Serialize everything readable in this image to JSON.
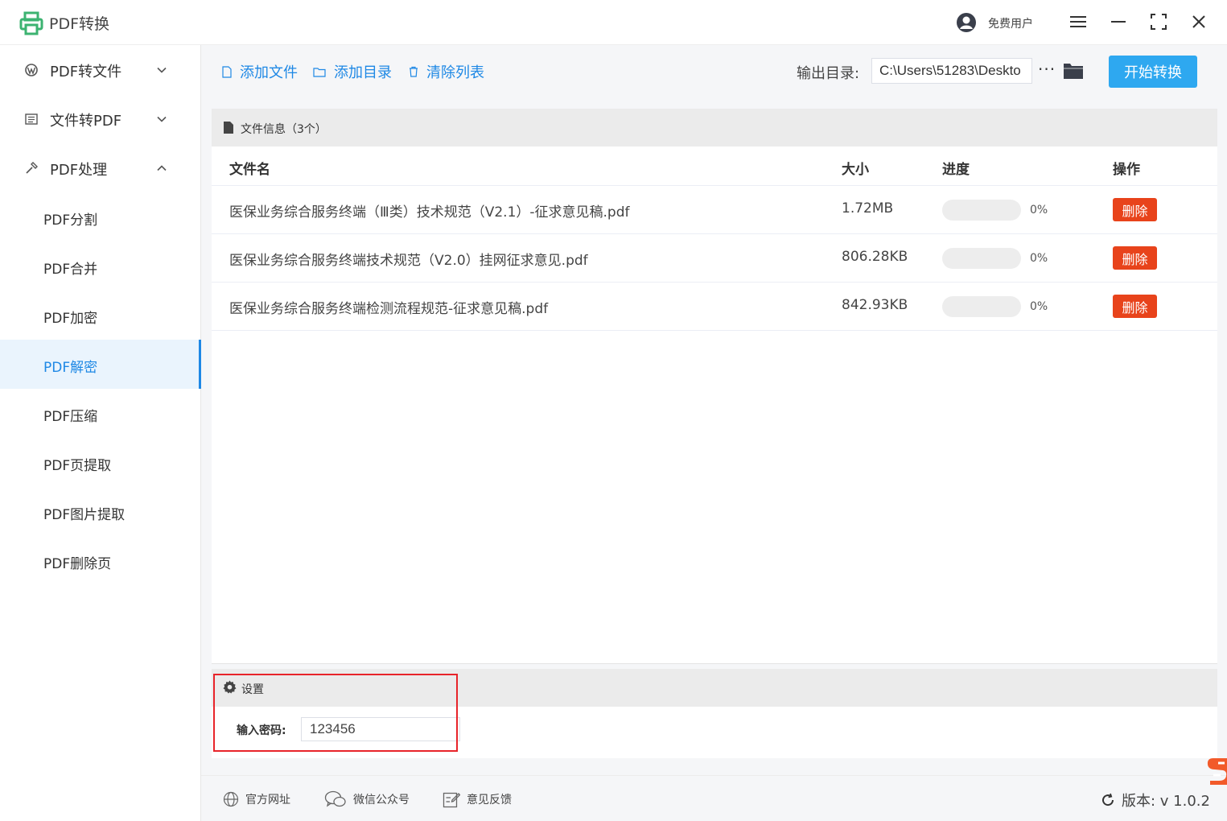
{
  "app": {
    "title": "PDF转换",
    "user_label": "免费用户"
  },
  "sidebar": {
    "groups": [
      {
        "label": "PDF转文件",
        "icon": "wordpress-icon",
        "expanded": false
      },
      {
        "label": "文件转PDF",
        "icon": "document-icon",
        "expanded": false
      },
      {
        "label": "PDF处理",
        "icon": "tool-icon",
        "expanded": true
      }
    ],
    "items": [
      {
        "label": "PDF分割"
      },
      {
        "label": "PDF合并"
      },
      {
        "label": "PDF加密"
      },
      {
        "label": "PDF解密",
        "active": true
      },
      {
        "label": "PDF压缩"
      },
      {
        "label": "PDF页提取"
      },
      {
        "label": "PDF图片提取"
      },
      {
        "label": "PDF删除页"
      }
    ]
  },
  "toolbar": {
    "add_file": "添加文件",
    "add_dir": "添加目录",
    "clear_list": "清除列表",
    "output_label": "输出目录:",
    "output_path": "C:\\Users\\51283\\Deskto",
    "more": "···",
    "start": "开始转换"
  },
  "file_panel": {
    "title": "文件信息（3个）",
    "columns": {
      "name": "文件名",
      "size": "大小",
      "progress": "进度",
      "action": "操作"
    },
    "rows": [
      {
        "name": "医保业务综合服务终端（Ⅲ类）技术规范（V2.1）-征求意见稿.pdf",
        "size": "1.72MB",
        "progress": 0,
        "progress_text": "0%",
        "action": "删除"
      },
      {
        "name": "医保业务综合服务终端技术规范（V2.0）挂网征求意见.pdf",
        "size": "806.28KB",
        "progress": 0,
        "progress_text": "0%",
        "action": "删除"
      },
      {
        "name": "医保业务综合服务终端检测流程规范-征求意见稿.pdf",
        "size": "842.93KB",
        "progress": 0,
        "progress_text": "0%",
        "action": "删除"
      }
    ]
  },
  "settings": {
    "title": "设置",
    "password_label": "输入密码:",
    "password_value": "123456"
  },
  "footer": {
    "website": "官方网址",
    "wechat": "微信公众号",
    "feedback": "意见反馈",
    "version": "版本:  v 1.0.2"
  },
  "colors": {
    "accent": "#1e88e5",
    "start_button": "#2ea8f0",
    "delete_button": "#e8431b",
    "logo_green": "#3cb371",
    "highlight": "#e8242a"
  }
}
